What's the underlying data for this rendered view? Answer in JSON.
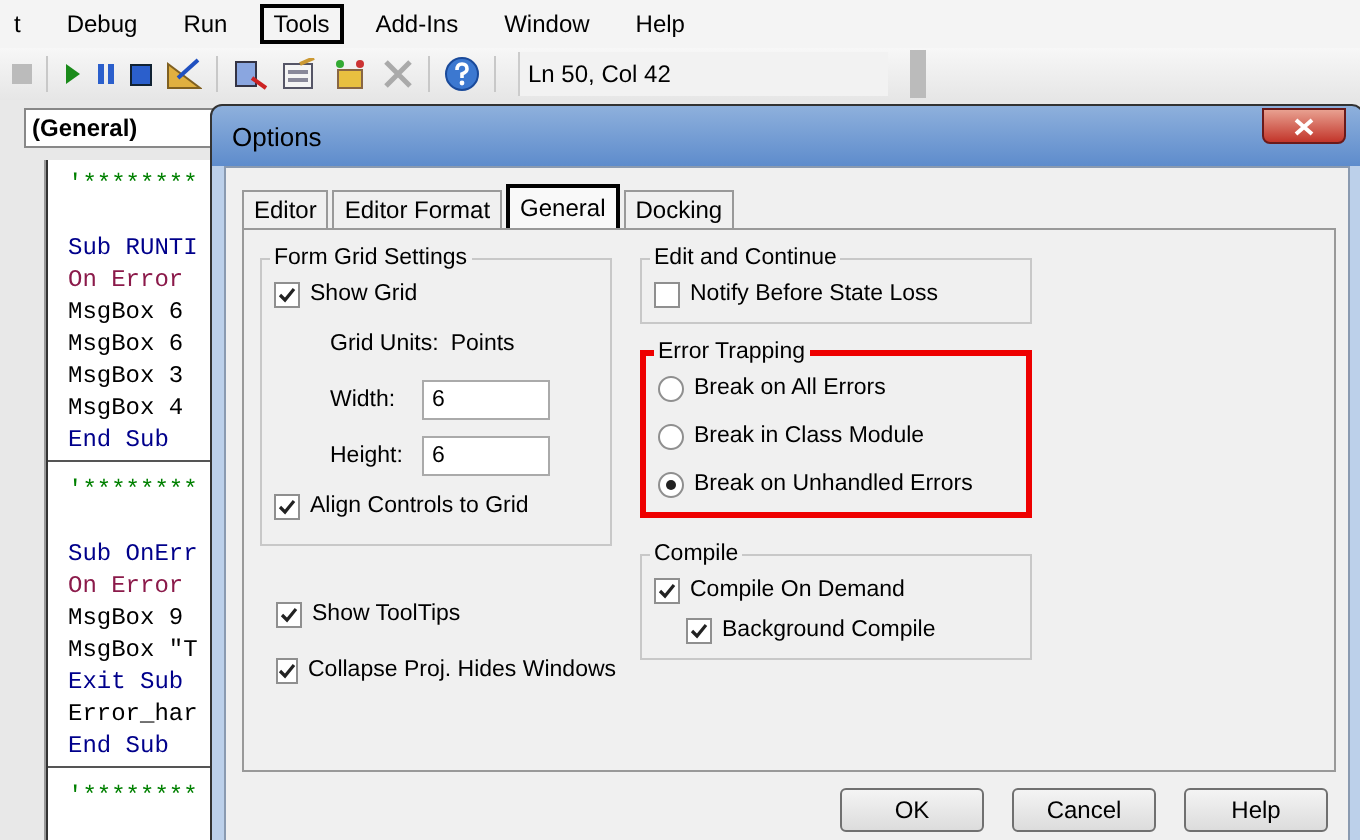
{
  "menu": [
    {
      "label": "t",
      "highlighted": false
    },
    {
      "label": "Debug",
      "highlighted": false
    },
    {
      "label": "Run",
      "highlighted": false
    },
    {
      "label": "Tools",
      "highlighted": true
    },
    {
      "label": "Add-Ins",
      "highlighted": false
    },
    {
      "label": "Window",
      "highlighted": false
    },
    {
      "label": "Help",
      "highlighted": false
    }
  ],
  "toolbar": {
    "position": "Ln 50, Col 42"
  },
  "editor": {
    "object_box": "(General)",
    "lines": [
      {
        "kind": "comment",
        "text": "'********"
      },
      {
        "kind": "blank"
      },
      {
        "kind": "keyword",
        "text": "Sub RUNTI"
      },
      {
        "kind": "error",
        "text": "On Error"
      },
      {
        "kind": "statement",
        "text": "MsgBox 6"
      },
      {
        "kind": "statement",
        "text": "MsgBox 6"
      },
      {
        "kind": "statement",
        "text": "MsgBox 3"
      },
      {
        "kind": "statement",
        "text": "MsgBox 4"
      },
      {
        "kind": "keyword",
        "text": "End Sub"
      },
      {
        "kind": "divider"
      },
      {
        "kind": "comment",
        "text": "'********"
      },
      {
        "kind": "blank"
      },
      {
        "kind": "keyword",
        "text": "Sub OnErr"
      },
      {
        "kind": "error",
        "text": "On Error"
      },
      {
        "kind": "statement",
        "text": "MsgBox 9"
      },
      {
        "kind": "statement",
        "text": "MsgBox \"T"
      },
      {
        "kind": "keyword",
        "text": "Exit Sub"
      },
      {
        "kind": "statement",
        "text": "Error_har"
      },
      {
        "kind": "keyword",
        "text": "End Sub"
      },
      {
        "kind": "divider"
      },
      {
        "kind": "comment",
        "text": "'********"
      }
    ]
  },
  "dialog": {
    "title": "Options",
    "tabs": [
      {
        "label": "Editor",
        "selected": false,
        "highlighted": false
      },
      {
        "label": "Editor Format",
        "selected": false,
        "highlighted": false
      },
      {
        "label": "General",
        "selected": true,
        "highlighted": true
      },
      {
        "label": "Docking",
        "selected": false,
        "highlighted": false
      }
    ],
    "form_grid": {
      "title": "Form Grid Settings",
      "show_grid": {
        "label": "Show Grid",
        "checked": true
      },
      "grid_units_label": "Grid Units:",
      "grid_units_value": "Points",
      "width_label": "Width:",
      "width_value": "6",
      "height_label": "Height:",
      "height_value": "6",
      "align": {
        "label": "Align Controls to Grid",
        "checked": true
      }
    },
    "options": [
      {
        "label": "Show ToolTips",
        "checked": true
      },
      {
        "label": "Collapse Proj. Hides Windows",
        "checked": true
      }
    ],
    "edit_continue": {
      "title": "Edit and Continue",
      "items": [
        {
          "label": "Notify Before State Loss",
          "checked": false
        }
      ]
    },
    "error_trapping": {
      "title": "Error Trapping",
      "highlighted": true,
      "options": [
        {
          "label": "Break on All Errors",
          "selected": false
        },
        {
          "label": "Break in Class Module",
          "selected": false
        },
        {
          "label": "Break on Unhandled Errors",
          "selected": true
        }
      ]
    },
    "compile": {
      "title": "Compile",
      "items": [
        {
          "label": "Compile On Demand",
          "checked": true,
          "children": [
            {
              "label": "Background Compile",
              "checked": true
            }
          ]
        }
      ]
    },
    "buttons": [
      "OK",
      "Cancel",
      "Help"
    ]
  }
}
